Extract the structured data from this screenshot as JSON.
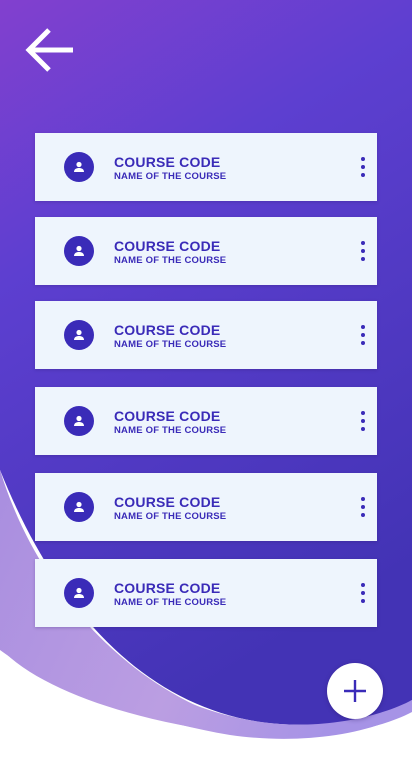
{
  "header": {
    "back_icon": "arrow-left-icon"
  },
  "courses": [
    {
      "code": "COURSE CODE",
      "name": "NAME OF THE COURSE",
      "avatar_icon": "person-icon",
      "menu_icon": "more-vertical-icon"
    },
    {
      "code": "COURSE CODE",
      "name": "NAME OF THE COURSE",
      "avatar_icon": "person-icon",
      "menu_icon": "more-vertical-icon"
    },
    {
      "code": "COURSE CODE",
      "name": "NAME OF THE COURSE",
      "avatar_icon": "person-icon",
      "menu_icon": "more-vertical-icon"
    },
    {
      "code": "COURSE CODE",
      "name": "NAME OF THE COURSE",
      "avatar_icon": "person-icon",
      "menu_icon": "more-vertical-icon"
    },
    {
      "code": "COURSE CODE",
      "name": "NAME OF THE COURSE",
      "avatar_icon": "person-icon",
      "menu_icon": "more-vertical-icon"
    },
    {
      "code": "COURSE CODE",
      "name": "NAME OF THE COURSE",
      "avatar_icon": "person-icon",
      "menu_icon": "more-vertical-icon"
    }
  ],
  "fab": {
    "icon": "plus-icon"
  },
  "colors": {
    "accent": "#3a2bb8",
    "card_background": "#eef5fd",
    "gradient_top": "#7b3fd0",
    "gradient_bottom": "#4535b8",
    "wave_light": "#b59be0"
  }
}
